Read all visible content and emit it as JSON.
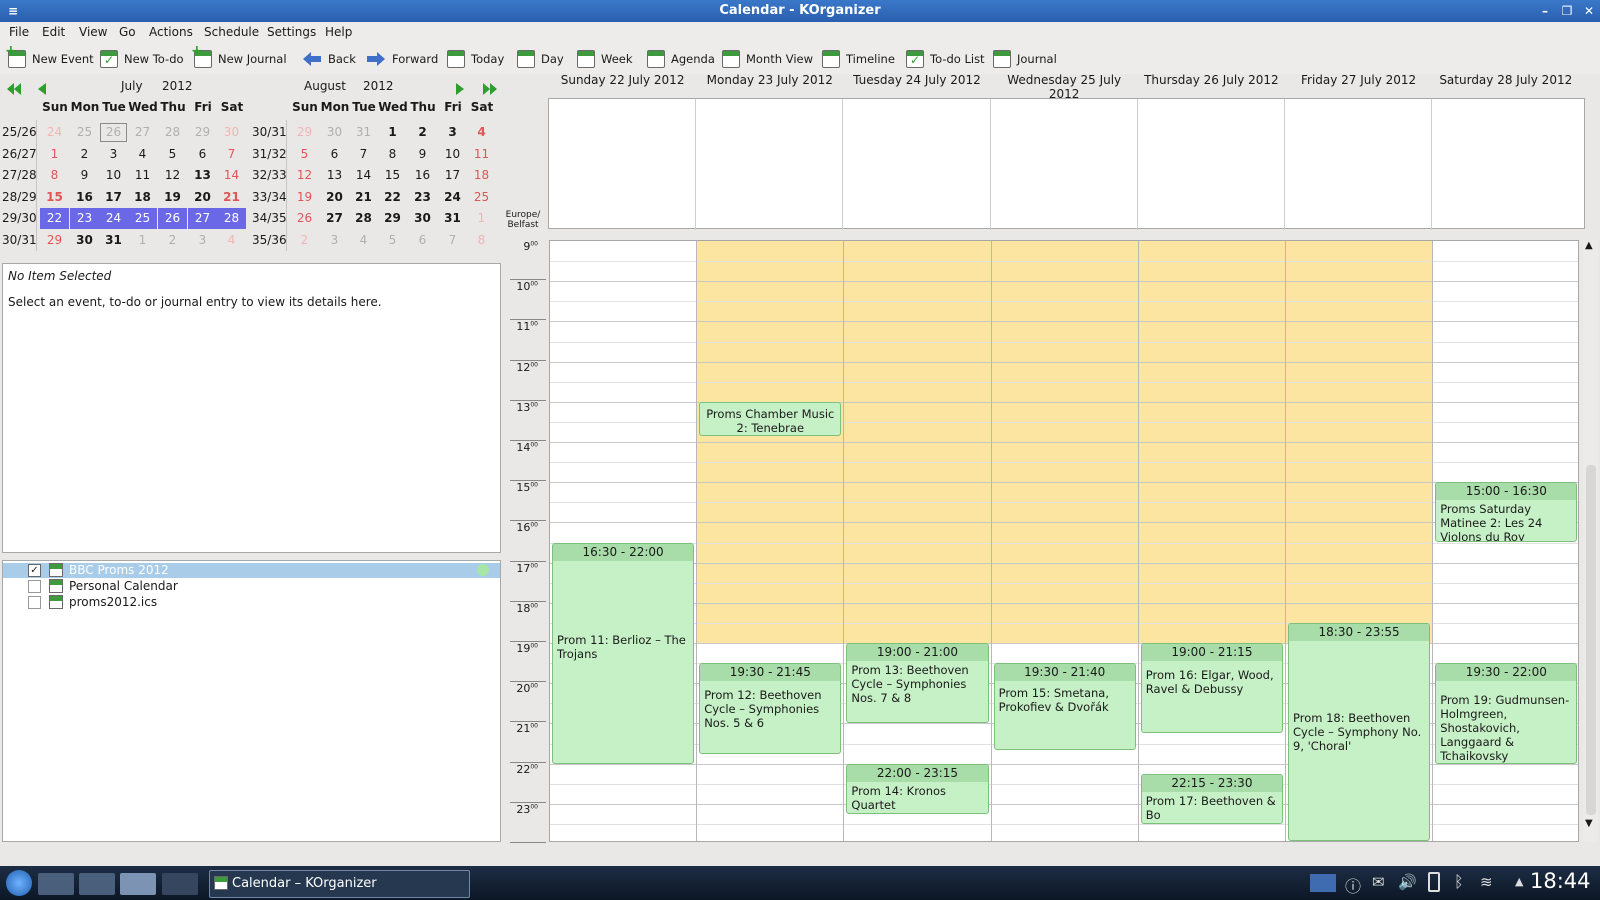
{
  "window": {
    "title": "Calendar - KOrganizer"
  },
  "menubar": [
    "File",
    "Edit",
    "View",
    "Go",
    "Actions",
    "Schedule",
    "Settings",
    "Help"
  ],
  "toolbar": [
    "New Event",
    "New To-do",
    "New Journal",
    "Back",
    "Forward",
    "Today",
    "Day",
    "Week",
    "Agenda",
    "Month View",
    "Timeline",
    "To-do List",
    "Journal"
  ],
  "mini_calendar": {
    "month1": "July",
    "year1": "2012",
    "month2": "August",
    "year2": "2012",
    "day_headers": [
      "Sun",
      "Mon",
      "Tue",
      "Wed",
      "Thu",
      "Fri",
      "Sat"
    ],
    "weeks1": [
      "25/26",
      "26/27",
      "27/28",
      "28/29",
      "29/30",
      "30/31"
    ],
    "weeks2": [
      "30/31",
      "31/32",
      "32/33",
      "33/34",
      "34/35",
      "35/36"
    ],
    "rows1": [
      [
        "24",
        "25",
        "26",
        "27",
        "28",
        "29",
        "30"
      ],
      [
        "1",
        "2",
        "3",
        "4",
        "5",
        "6",
        "7"
      ],
      [
        "8",
        "9",
        "10",
        "11",
        "12",
        "13",
        "14"
      ],
      [
        "15",
        "16",
        "17",
        "18",
        "19",
        "20",
        "21"
      ],
      [
        "22",
        "23",
        "24",
        "25",
        "26",
        "27",
        "28"
      ],
      [
        "29",
        "30",
        "31",
        "1",
        "2",
        "3",
        "4"
      ]
    ],
    "rows2": [
      [
        "29",
        "30",
        "31",
        "1",
        "2",
        "3",
        "4"
      ],
      [
        "5",
        "6",
        "7",
        "8",
        "9",
        "10",
        "11"
      ],
      [
        "12",
        "13",
        "14",
        "15",
        "16",
        "17",
        "18"
      ],
      [
        "19",
        "20",
        "21",
        "22",
        "23",
        "24",
        "25"
      ],
      [
        "26",
        "27",
        "28",
        "29",
        "30",
        "31",
        "1"
      ],
      [
        "2",
        "3",
        "4",
        "5",
        "6",
        "7",
        "8"
      ]
    ]
  },
  "detail": {
    "heading": "No Item Selected",
    "text": "Select an event, to-do or journal entry to view its details here."
  },
  "calendars": [
    "BBC Proms 2012",
    "Personal Calendar",
    "proms2012.ics"
  ],
  "agenda": {
    "timezone_line1": "Europe/",
    "timezone_line2": "Belfast",
    "days": [
      "Sunday 22 July 2012",
      "Monday 23 July 2012",
      "Tuesday 24 July 2012",
      "Wednesday 25 July 2012",
      "Thursday 26 July 2012",
      "Friday 27 July 2012",
      "Saturday 28 July 2012"
    ],
    "hours": [
      "9",
      "10",
      "11",
      "12",
      "13",
      "14",
      "15",
      "16",
      "17",
      "18",
      "19",
      "20",
      "21",
      "22",
      "23"
    ],
    "hour_suffix": "00",
    "events": [
      {
        "day": 0,
        "start": 16.5,
        "end": 22.0,
        "time": "16:30 - 22:00",
        "name": "Prom 11: Berlioz – The Trojans"
      },
      {
        "day": 1,
        "start": 13.0,
        "end": 13.85,
        "time": "",
        "name": "Proms Chamber Music 2: Tenebrae"
      },
      {
        "day": 1,
        "start": 19.5,
        "end": 21.75,
        "time": "19:30 - 21:45",
        "name": "Prom 12: Beethoven Cycle – Symphonies Nos. 5 & 6"
      },
      {
        "day": 2,
        "start": 19.0,
        "end": 21.0,
        "time": "19:00 - 21:00",
        "name": "Prom 13: Beethoven Cycle – Symphonies Nos. 7 & 8"
      },
      {
        "day": 2,
        "start": 22.0,
        "end": 23.25,
        "time": "22:00 - 23:15",
        "name": "Prom 14: Kronos Quartet"
      },
      {
        "day": 3,
        "start": 19.5,
        "end": 21.67,
        "time": "19:30 - 21:40",
        "name": "Prom 15: Smetana, Prokofiev & Dvořák"
      },
      {
        "day": 4,
        "start": 19.0,
        "end": 21.25,
        "time": "19:00 - 21:15",
        "name": "Prom 16: Elgar, Wood, Ravel & Debussy"
      },
      {
        "day": 4,
        "start": 22.25,
        "end": 23.5,
        "time": "22:15 - 23:30",
        "name": "Prom 17: Beethoven & Bo"
      },
      {
        "day": 5,
        "start": 18.5,
        "end": 23.92,
        "time": "18:30 - 23:55",
        "name": "Prom 18: Beethoven Cycle – Symphony No. 9, 'Choral'"
      },
      {
        "day": 6,
        "start": 15.0,
        "end": 16.5,
        "time": "15:00 - 16:30",
        "name": "Proms Saturday Matinee 2: Les 24 Violons du Roy"
      },
      {
        "day": 6,
        "start": 19.5,
        "end": 22.0,
        "time": "19:30 - 22:00",
        "name": "Prom 19: Gudmunsen-Holmgreen, Shostakovich, Langgaard & Tchaikovsky"
      }
    ]
  },
  "taskbar": {
    "task": "Calendar – KOrganizer",
    "clock": "18:44"
  },
  "colors": {
    "workhours": "#fbe5a0",
    "event": "#c6f0c6",
    "selection": "#6b68e8",
    "titlebar": "#2f68b8"
  }
}
